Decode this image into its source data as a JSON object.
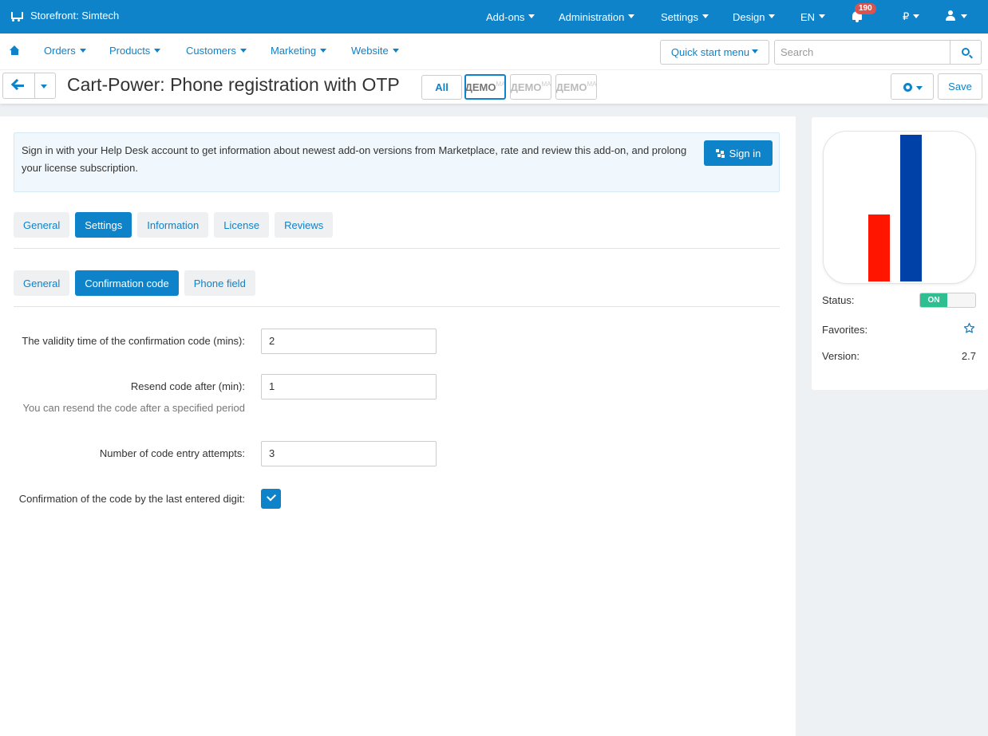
{
  "topbar": {
    "store": "Storefront: Simtech",
    "menu": [
      "Add-ons",
      "Administration",
      "Settings",
      "Design",
      "EN"
    ],
    "notifications": "190",
    "currency": "₽"
  },
  "nav": {
    "items": [
      "Orders",
      "Products",
      "Customers",
      "Marketing",
      "Website"
    ],
    "quick_start": "Quick start menu",
    "search_placeholder": "Search"
  },
  "titlebar": {
    "title": "Cart-Power: Phone registration with OTP",
    "all_label": "All",
    "demo_label": "ДЕМО",
    "demo_sup": "МА",
    "save_label": "Save"
  },
  "notice": {
    "text": "Sign in with your Help Desk account to get information about newest add-on versions from Marketplace, rate and review this add-on, and prolong your license subscription.",
    "button": "Sign in"
  },
  "tabs": [
    "General",
    "Settings",
    "Information",
    "License",
    "Reviews"
  ],
  "subtabs": [
    "General",
    "Confirmation code",
    "Phone field"
  ],
  "fields": {
    "validity_label": "The validity time of the confirmation code (mins):",
    "validity_value": "2",
    "resend_label": "Resend code after (min):",
    "resend_value": "1",
    "resend_hint": "You can resend the code after a specified period",
    "attempts_label": "Number of code entry attempts:",
    "attempts_value": "3",
    "last_digit_label": "Confirmation of the code by the last entered digit:",
    "last_digit_checked": true
  },
  "sidebar": {
    "status_label": "Status:",
    "status_value": "ON",
    "favorites_label": "Favorites:",
    "version_label": "Version:",
    "version_value": "2.7"
  },
  "colors": {
    "primary": "#0e83c9",
    "on_green": "#2ebf91",
    "logo_red": "#ff1500",
    "logo_blue": "#0041a8"
  }
}
